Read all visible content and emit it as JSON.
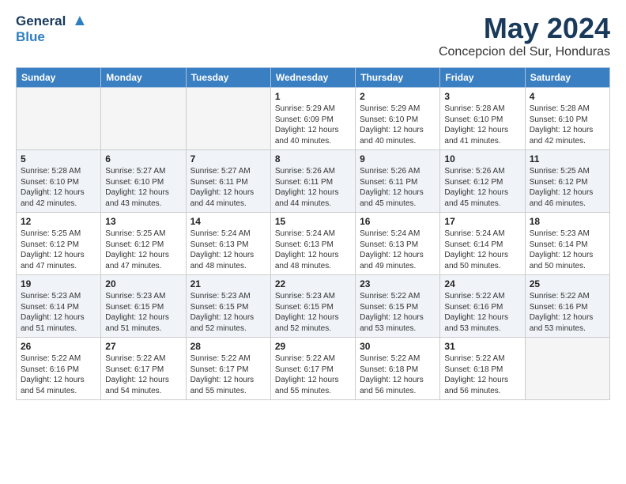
{
  "header": {
    "logo_line1": "General",
    "logo_line2": "Blue",
    "month_title": "May 2024",
    "location": "Concepcion del Sur, Honduras"
  },
  "days_of_week": [
    "Sunday",
    "Monday",
    "Tuesday",
    "Wednesday",
    "Thursday",
    "Friday",
    "Saturday"
  ],
  "weeks": [
    [
      {
        "day": "",
        "sunrise": "",
        "sunset": "",
        "daylight": "",
        "empty": true
      },
      {
        "day": "",
        "sunrise": "",
        "sunset": "",
        "daylight": "",
        "empty": true
      },
      {
        "day": "",
        "sunrise": "",
        "sunset": "",
        "daylight": "",
        "empty": true
      },
      {
        "day": "1",
        "sunrise": "Sunrise: 5:29 AM",
        "sunset": "Sunset: 6:09 PM",
        "daylight": "Daylight: 12 hours and 40 minutes.",
        "empty": false
      },
      {
        "day": "2",
        "sunrise": "Sunrise: 5:29 AM",
        "sunset": "Sunset: 6:10 PM",
        "daylight": "Daylight: 12 hours and 40 minutes.",
        "empty": false
      },
      {
        "day": "3",
        "sunrise": "Sunrise: 5:28 AM",
        "sunset": "Sunset: 6:10 PM",
        "daylight": "Daylight: 12 hours and 41 minutes.",
        "empty": false
      },
      {
        "day": "4",
        "sunrise": "Sunrise: 5:28 AM",
        "sunset": "Sunset: 6:10 PM",
        "daylight": "Daylight: 12 hours and 42 minutes.",
        "empty": false
      }
    ],
    [
      {
        "day": "5",
        "sunrise": "Sunrise: 5:28 AM",
        "sunset": "Sunset: 6:10 PM",
        "daylight": "Daylight: 12 hours and 42 minutes.",
        "empty": false
      },
      {
        "day": "6",
        "sunrise": "Sunrise: 5:27 AM",
        "sunset": "Sunset: 6:10 PM",
        "daylight": "Daylight: 12 hours and 43 minutes.",
        "empty": false
      },
      {
        "day": "7",
        "sunrise": "Sunrise: 5:27 AM",
        "sunset": "Sunset: 6:11 PM",
        "daylight": "Daylight: 12 hours and 44 minutes.",
        "empty": false
      },
      {
        "day": "8",
        "sunrise": "Sunrise: 5:26 AM",
        "sunset": "Sunset: 6:11 PM",
        "daylight": "Daylight: 12 hours and 44 minutes.",
        "empty": false
      },
      {
        "day": "9",
        "sunrise": "Sunrise: 5:26 AM",
        "sunset": "Sunset: 6:11 PM",
        "daylight": "Daylight: 12 hours and 45 minutes.",
        "empty": false
      },
      {
        "day": "10",
        "sunrise": "Sunrise: 5:26 AM",
        "sunset": "Sunset: 6:12 PM",
        "daylight": "Daylight: 12 hours and 45 minutes.",
        "empty": false
      },
      {
        "day": "11",
        "sunrise": "Sunrise: 5:25 AM",
        "sunset": "Sunset: 6:12 PM",
        "daylight": "Daylight: 12 hours and 46 minutes.",
        "empty": false
      }
    ],
    [
      {
        "day": "12",
        "sunrise": "Sunrise: 5:25 AM",
        "sunset": "Sunset: 6:12 PM",
        "daylight": "Daylight: 12 hours and 47 minutes.",
        "empty": false
      },
      {
        "day": "13",
        "sunrise": "Sunrise: 5:25 AM",
        "sunset": "Sunset: 6:12 PM",
        "daylight": "Daylight: 12 hours and 47 minutes.",
        "empty": false
      },
      {
        "day": "14",
        "sunrise": "Sunrise: 5:24 AM",
        "sunset": "Sunset: 6:13 PM",
        "daylight": "Daylight: 12 hours and 48 minutes.",
        "empty": false
      },
      {
        "day": "15",
        "sunrise": "Sunrise: 5:24 AM",
        "sunset": "Sunset: 6:13 PM",
        "daylight": "Daylight: 12 hours and 48 minutes.",
        "empty": false
      },
      {
        "day": "16",
        "sunrise": "Sunrise: 5:24 AM",
        "sunset": "Sunset: 6:13 PM",
        "daylight": "Daylight: 12 hours and 49 minutes.",
        "empty": false
      },
      {
        "day": "17",
        "sunrise": "Sunrise: 5:24 AM",
        "sunset": "Sunset: 6:14 PM",
        "daylight": "Daylight: 12 hours and 50 minutes.",
        "empty": false
      },
      {
        "day": "18",
        "sunrise": "Sunrise: 5:23 AM",
        "sunset": "Sunset: 6:14 PM",
        "daylight": "Daylight: 12 hours and 50 minutes.",
        "empty": false
      }
    ],
    [
      {
        "day": "19",
        "sunrise": "Sunrise: 5:23 AM",
        "sunset": "Sunset: 6:14 PM",
        "daylight": "Daylight: 12 hours and 51 minutes.",
        "empty": false
      },
      {
        "day": "20",
        "sunrise": "Sunrise: 5:23 AM",
        "sunset": "Sunset: 6:15 PM",
        "daylight": "Daylight: 12 hours and 51 minutes.",
        "empty": false
      },
      {
        "day": "21",
        "sunrise": "Sunrise: 5:23 AM",
        "sunset": "Sunset: 6:15 PM",
        "daylight": "Daylight: 12 hours and 52 minutes.",
        "empty": false
      },
      {
        "day": "22",
        "sunrise": "Sunrise: 5:23 AM",
        "sunset": "Sunset: 6:15 PM",
        "daylight": "Daylight: 12 hours and 52 minutes.",
        "empty": false
      },
      {
        "day": "23",
        "sunrise": "Sunrise: 5:22 AM",
        "sunset": "Sunset: 6:15 PM",
        "daylight": "Daylight: 12 hours and 53 minutes.",
        "empty": false
      },
      {
        "day": "24",
        "sunrise": "Sunrise: 5:22 AM",
        "sunset": "Sunset: 6:16 PM",
        "daylight": "Daylight: 12 hours and 53 minutes.",
        "empty": false
      },
      {
        "day": "25",
        "sunrise": "Sunrise: 5:22 AM",
        "sunset": "Sunset: 6:16 PM",
        "daylight": "Daylight: 12 hours and 53 minutes.",
        "empty": false
      }
    ],
    [
      {
        "day": "26",
        "sunrise": "Sunrise: 5:22 AM",
        "sunset": "Sunset: 6:16 PM",
        "daylight": "Daylight: 12 hours and 54 minutes.",
        "empty": false
      },
      {
        "day": "27",
        "sunrise": "Sunrise: 5:22 AM",
        "sunset": "Sunset: 6:17 PM",
        "daylight": "Daylight: 12 hours and 54 minutes.",
        "empty": false
      },
      {
        "day": "28",
        "sunrise": "Sunrise: 5:22 AM",
        "sunset": "Sunset: 6:17 PM",
        "daylight": "Daylight: 12 hours and 55 minutes.",
        "empty": false
      },
      {
        "day": "29",
        "sunrise": "Sunrise: 5:22 AM",
        "sunset": "Sunset: 6:17 PM",
        "daylight": "Daylight: 12 hours and 55 minutes.",
        "empty": false
      },
      {
        "day": "30",
        "sunrise": "Sunrise: 5:22 AM",
        "sunset": "Sunset: 6:18 PM",
        "daylight": "Daylight: 12 hours and 56 minutes.",
        "empty": false
      },
      {
        "day": "31",
        "sunrise": "Sunrise: 5:22 AM",
        "sunset": "Sunset: 6:18 PM",
        "daylight": "Daylight: 12 hours and 56 minutes.",
        "empty": false
      },
      {
        "day": "",
        "sunrise": "",
        "sunset": "",
        "daylight": "",
        "empty": true
      }
    ]
  ]
}
